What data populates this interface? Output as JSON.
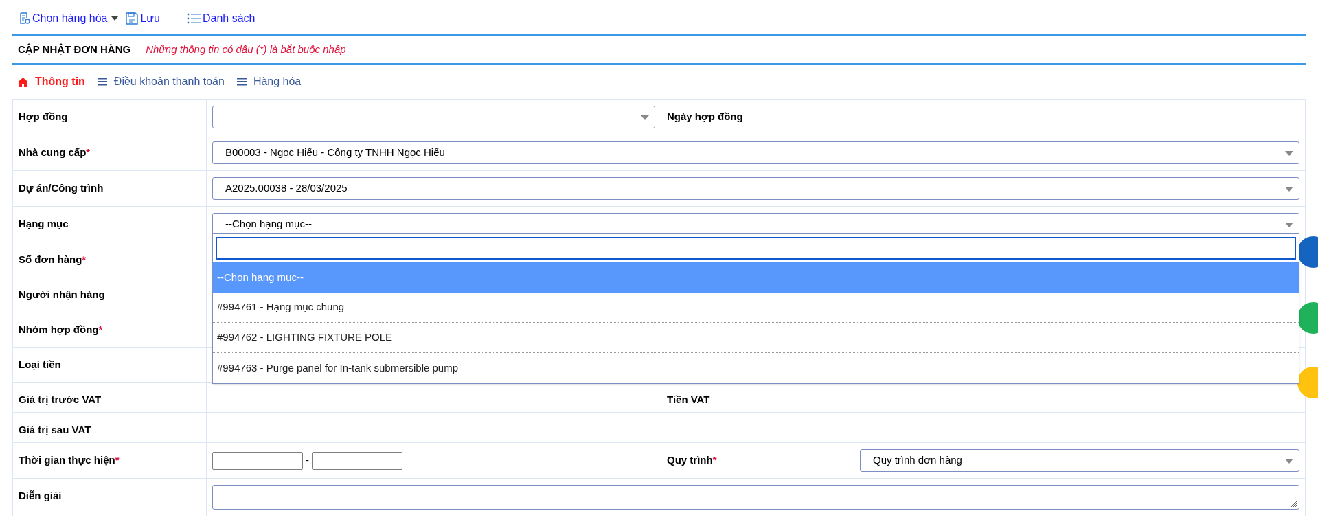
{
  "toolbar": [
    {
      "kind": "goods",
      "label": "Chọn hàng hóa",
      "caret": true
    },
    {
      "kind": "save",
      "label": "Lưu",
      "caret": false
    },
    {
      "kind": "list",
      "label": "Danh sách",
      "caret": false
    }
  ],
  "header": {
    "title": "CẬP NHẬT ĐƠN HÀNG",
    "note": "Những thông tin có dấu (*) là bắt buộc nhập"
  },
  "tabs": [
    {
      "kind": "home",
      "label": "Thông tin",
      "selected": true
    },
    {
      "kind": "list",
      "label": "Điều khoản thanh toán",
      "selected": false
    },
    {
      "kind": "list",
      "label": "Hàng hóa",
      "selected": false
    }
  ],
  "rows": [
    {
      "label": "Hợp đồng",
      "kind": "split",
      "value": {
        "kind": "select"
      },
      "right": {
        "label": "Ngày hợp đồng"
      }
    },
    {
      "label": "Nhà cung cấp",
      "required_mark": "*",
      "kind": "full",
      "value": {
        "kind": "select",
        "text": "B00003 - Ngọc Hiếu - Công ty TNHH Ngọc Hiếu"
      }
    },
    {
      "label": "Dự án/Công trình",
      "kind": "full",
      "value": {
        "kind": "select",
        "text": "A2025.00038 - 28/03/2025"
      }
    },
    {
      "label": "Hạng mục",
      "kind": "full",
      "value": {
        "kind": "select",
        "text": "--Chọn hạng mục--",
        "open": true
      }
    },
    {
      "label": "Số đơn hàng",
      "required_mark": "*",
      "kind": "full",
      "value": {
        "kind": "blank"
      }
    },
    {
      "label": "Người nhận hàng",
      "kind": "full",
      "value": {
        "kind": "blank"
      }
    },
    {
      "label": "Nhóm hợp đồng",
      "required_mark": "*",
      "kind": "full",
      "value": {
        "kind": "blank"
      }
    },
    {
      "label": "Loại tiền",
      "kind": "full",
      "value": {
        "kind": "blank"
      }
    },
    {
      "label": "Giá trị trước VAT",
      "kind": "split",
      "value": {
        "kind": "blank"
      },
      "right": {
        "label": "Tiền VAT"
      }
    },
    {
      "label": "Giá trị sau VAT",
      "kind": "split",
      "value": {
        "kind": "blank"
      },
      "right": {}
    },
    {
      "label": "Thời gian thực hiện",
      "required_mark": "*",
      "kind": "split",
      "value": {
        "kind": "date_range",
        "separator": "-"
      },
      "right": {
        "label": "Quy trình",
        "required_mark": "*",
        "value": {
          "kind": "select",
          "text": "Quy trình đơn hàng"
        }
      }
    },
    {
      "label": "Diễn giải",
      "kind": "full",
      "value": {
        "kind": "textarea"
      }
    }
  ],
  "dropdown": {
    "options": [
      {
        "label": "--Chọn hạng mục--",
        "selected": true
      },
      {
        "label": "#994761 - Hạng mục chung",
        "selected": false
      },
      {
        "label": "#994762 - LIGHTING FIXTURE POLE",
        "selected": false
      },
      {
        "label": "#994763 - Purge panel for In-tank submersible pump",
        "selected": false
      }
    ]
  }
}
